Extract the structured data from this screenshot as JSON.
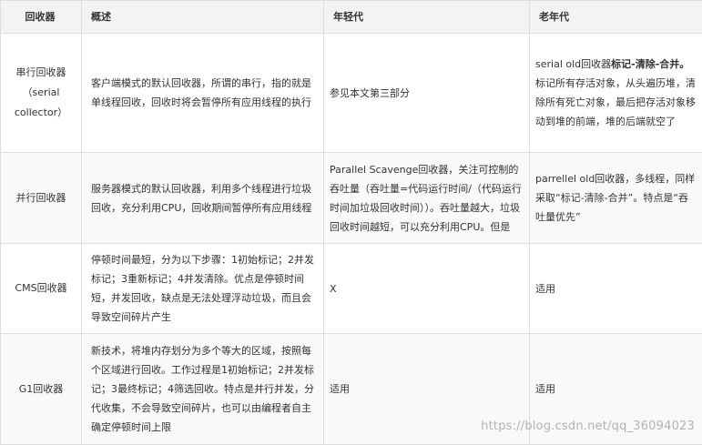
{
  "table": {
    "headers": [
      "回收器",
      "概述",
      "年轻代",
      "老年代"
    ],
    "rows": [
      {
        "name": "串行回收器\n（serial\ncollector）",
        "overview": "客户端模式的默认回收器，所谓的串行，指的就是单线程回收，回收时将会暂停所有应用线程的执行",
        "young": "参见本文第三部分",
        "old_prefix": "serial old回收器",
        "old_bold": "标记-清除-合并。",
        "old_rest": "标记所有存活对象，从头遍历堆，清除所有死亡对象，最后把存活对象移动到堆的前端，堆的后端就空了"
      },
      {
        "name": "并行回收器",
        "overview": "服务器模式的默认回收器，利用多个线程进行垃圾回收，充分利用CPU，回收期间暂停所有应用线程",
        "young": "Parallel Scavenge回收器，关注可控制的吞吐量（吞吐量=代码运行时间/（代码运行时间加垃圾回收时间））。吞吐量越大，垃圾回收时间越短，可以充分利用CPU。但是",
        "old": "parrellel old回收器，多线程，同样采取“标记-清除-合并”。特点是“吞吐量优先”"
      },
      {
        "name": "CMS回收器",
        "overview": "停顿时间最短，分为以下步骤：1初始标记；2并发标记；3重新标记；4并发清除。优点是停顿时间短，并发回收，缺点是无法处理浮动垃圾，而且会导致空间碎片产生",
        "young": "X",
        "old": "适用"
      },
      {
        "name": "G1回收器",
        "overview": "新技术，将堆内存划分为多个等大的区域，按照每个区域进行回收。工作过程是1初始标记；2并发标记；3最终标记；4筛选回收。特点是并行并发，分代收集，不会导致空间碎片，也可以由编程者自主确定停顿时间上限",
        "young": "适用",
        "old": "适用"
      }
    ]
  },
  "watermark": "https://blog.csdn.net/qq_36094023"
}
